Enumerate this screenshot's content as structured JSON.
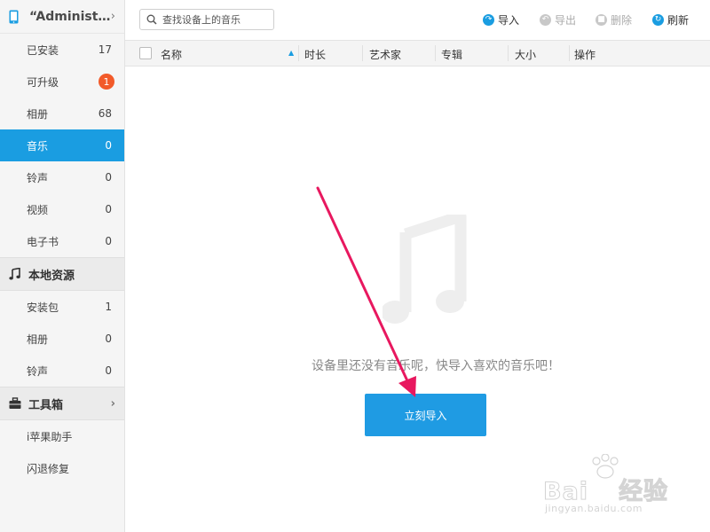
{
  "sidebar": {
    "device": {
      "name": "“Administ…",
      "icon": "phone-icon"
    },
    "device_items": [
      {
        "label": "已安装",
        "count": "17"
      },
      {
        "label": "可升级",
        "count": "1",
        "badge": true
      },
      {
        "label": "相册",
        "count": "68"
      },
      {
        "label": "音乐",
        "count": "0",
        "active": true
      },
      {
        "label": "铃声",
        "count": "0"
      },
      {
        "label": "视频",
        "count": "0"
      },
      {
        "label": "电子书",
        "count": "0"
      }
    ],
    "local_section": {
      "title": "本地资源",
      "icon": "music-note-icon"
    },
    "local_items": [
      {
        "label": "安装包",
        "count": "1"
      },
      {
        "label": "相册",
        "count": "0"
      },
      {
        "label": "铃声",
        "count": "0"
      }
    ],
    "toolbox_section": {
      "title": "工具箱",
      "icon": "toolbox-icon"
    },
    "toolbox_items": [
      {
        "label": "i苹果助手"
      },
      {
        "label": "闪退修复"
      }
    ]
  },
  "toolbar": {
    "search_placeholder": "查找设备上的音乐",
    "import_label": "导入",
    "export_label": "导出",
    "delete_label": "删除",
    "refresh_label": "刷新"
  },
  "table": {
    "columns": [
      "名称",
      "时长",
      "艺术家",
      "专辑",
      "大小",
      "操作"
    ]
  },
  "empty_state": {
    "message": "设备里还没有音乐呢，快导入喜欢的音乐吧！",
    "button_label": "立刻导入"
  },
  "watermark": {
    "logo": "Bai du 经验",
    "url": "jingyan.baidu.com"
  },
  "colors": {
    "accent": "#1a9de1",
    "badge": "#f25a29",
    "arrow": "#e8185f"
  }
}
